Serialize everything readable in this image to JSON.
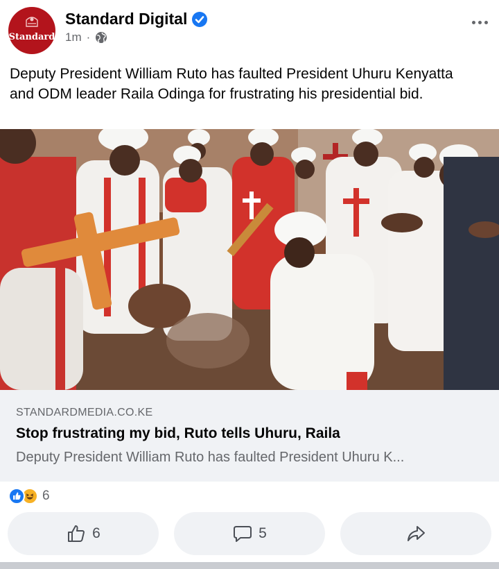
{
  "post": {
    "page_name": "Standard Digital",
    "avatar_text": "Standard",
    "time": "1m",
    "separator": "·",
    "text": "Deputy President William Ruto has faulted President Uhuru Kenyatta and ODM leader Raila Odinga for frustrating his presidential bid."
  },
  "link": {
    "domain": "STANDARDMEDIA.CO.KE",
    "title": "Stop frustrating my bid, Ruto tells Uhuru, Raila",
    "description": "Deputy President William Ruto has faulted President Uhuru K..."
  },
  "reactions": {
    "types": [
      "like-icon",
      "haha-icon"
    ],
    "count": "6"
  },
  "actions": {
    "like_count": "6",
    "comment_count": "5"
  },
  "colors": {
    "brand_blue": "#1877f2",
    "avatar_red": "#b3141c",
    "secondary_text": "#65676b",
    "surface": "#f0f2f5"
  }
}
